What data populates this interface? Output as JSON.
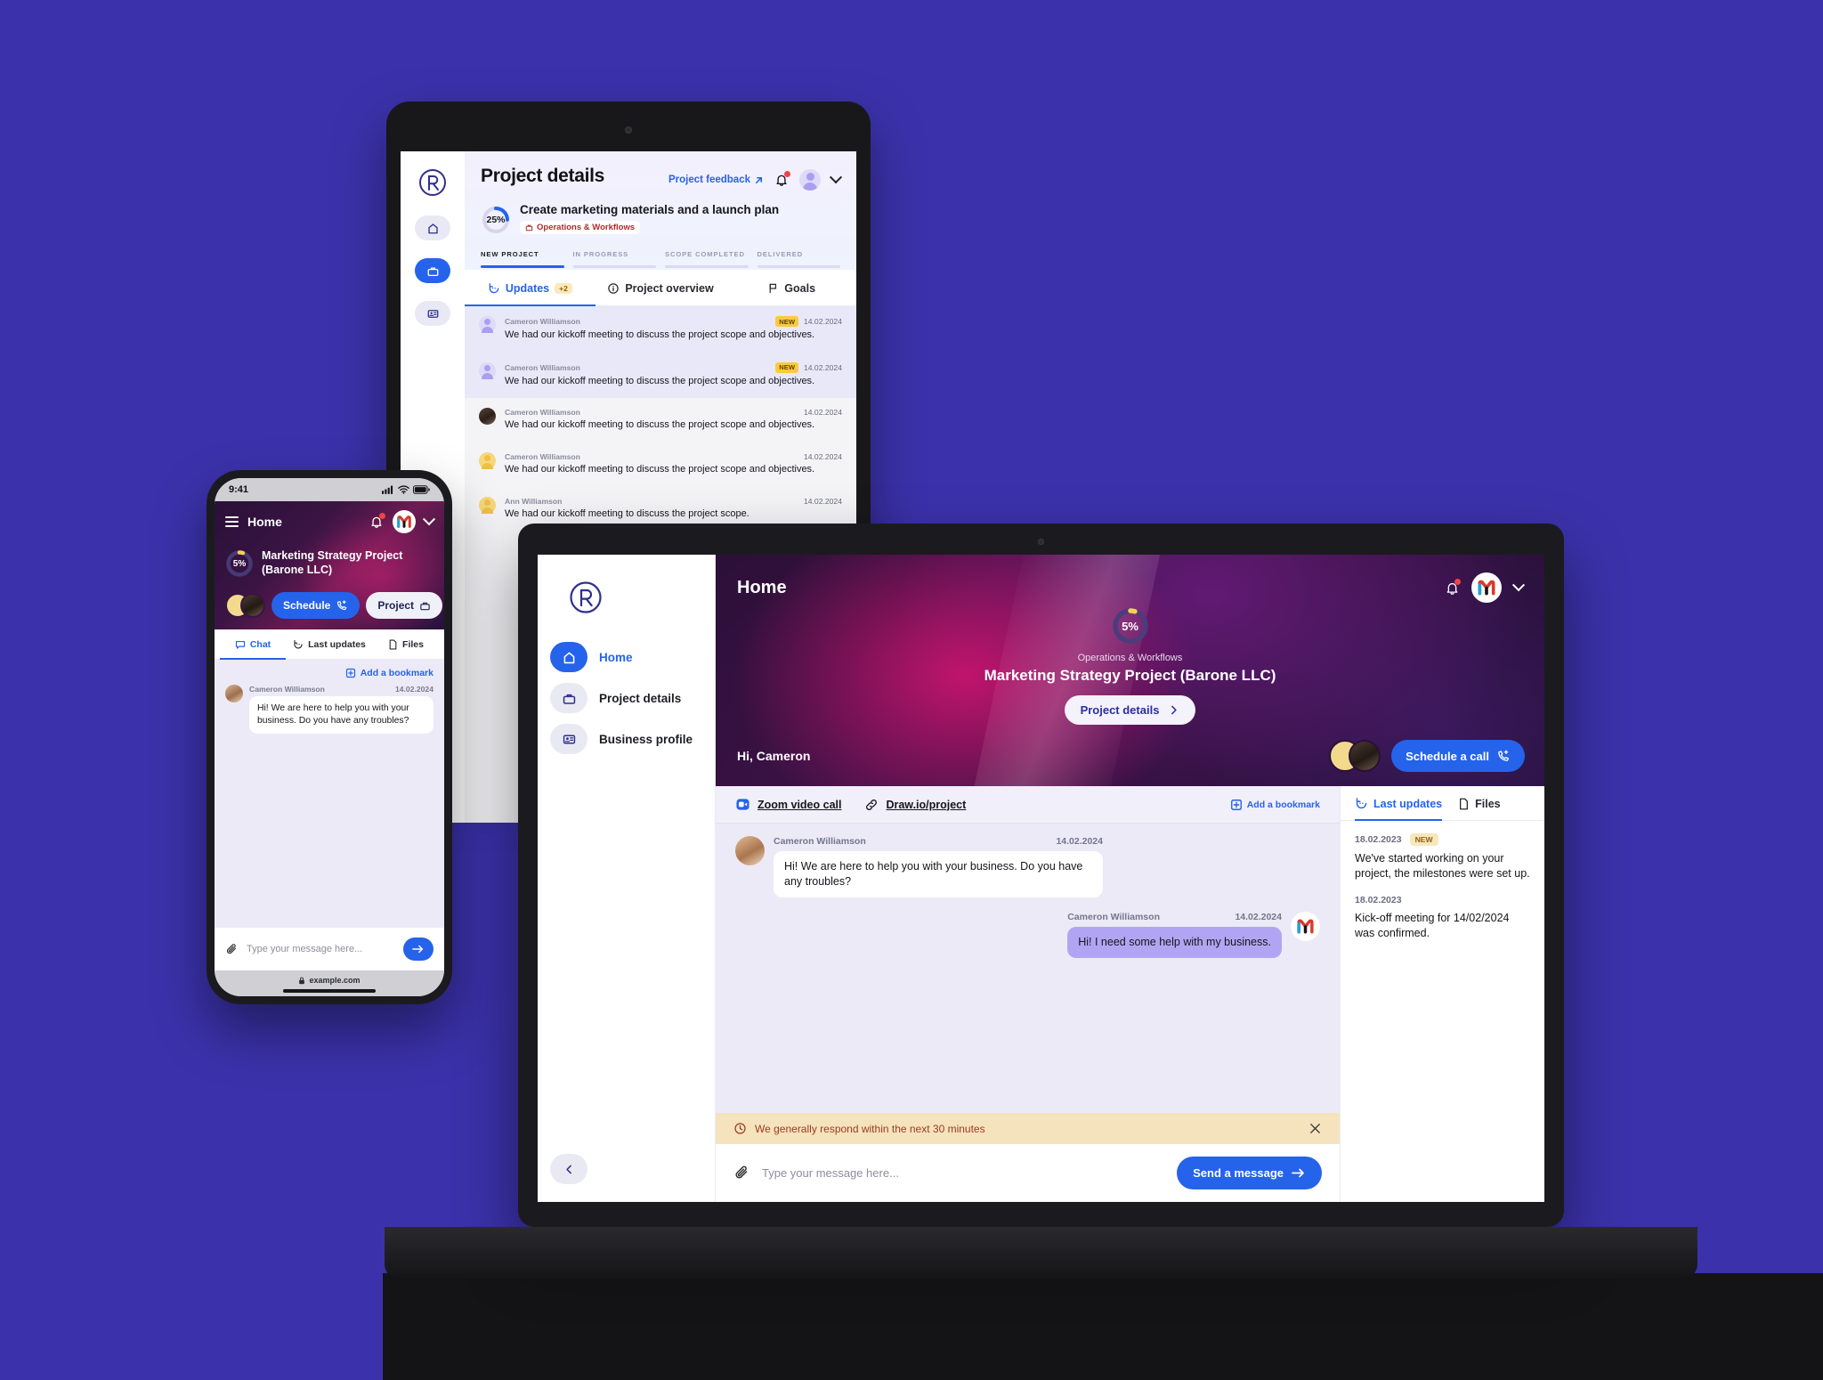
{
  "brand": {
    "logo_letter": "R",
    "accent": "#2563eb",
    "background": "#3b32ab"
  },
  "tablet": {
    "page_title": "Project details",
    "feedback_link": "Project feedback",
    "rail": [
      {
        "name": "home",
        "icon": "home-icon",
        "active": false
      },
      {
        "name": "project",
        "icon": "briefcase-icon",
        "active": true
      },
      {
        "name": "business-profile",
        "icon": "id-card-icon",
        "active": false
      }
    ],
    "progress_percent": "25%",
    "project_headline": "Create marketing materials and a launch plan",
    "project_tag": "Operations & Workflows",
    "stages": [
      {
        "label": "NEW PROJECT",
        "done": true
      },
      {
        "label": "IN PROGRESS",
        "done": false
      },
      {
        "label": "SCOPE COMPLETED",
        "done": false
      },
      {
        "label": "DELIVERED",
        "done": false
      }
    ],
    "tabs": [
      {
        "label": "Updates",
        "badge": "+2",
        "active": true
      },
      {
        "label": "Project overview",
        "badge": "",
        "active": false
      },
      {
        "label": "Goals",
        "badge": "",
        "active": false
      }
    ],
    "updates": [
      {
        "author": "Cameron Williamson",
        "badge": "NEW",
        "date": "14.02.2024",
        "text": "We had our kickoff meeting to discuss the project scope and objectives.",
        "unread": true,
        "avatar": "ph-purple"
      },
      {
        "author": "Cameron Williamson",
        "badge": "NEW",
        "date": "14.02.2024",
        "text": "We had our kickoff meeting to discuss the project scope and objectives.",
        "unread": true,
        "avatar": "ph-purple"
      },
      {
        "author": "Cameron Williamson",
        "badge": "",
        "date": "14.02.2024",
        "text": "We had our kickoff meeting to discuss the project scope and objectives.",
        "unread": false,
        "avatar": "photo"
      },
      {
        "author": "Cameron Williamson",
        "badge": "",
        "date": "14.02.2024",
        "text": "We had our kickoff meeting to discuss the project scope and objectives.",
        "unread": false,
        "avatar": "ph-yellow"
      },
      {
        "author": "Ann Williamson",
        "badge": "",
        "date": "14.02.2024",
        "text": "We had our kickoff meeting to discuss the project scope.",
        "unread": false,
        "avatar": "ph-yellow"
      }
    ]
  },
  "phone": {
    "status_time": "9:41",
    "nav_title": "Home",
    "progress_percent": "5%",
    "project_name": "Marketing Strategy Project (Barone LLC)",
    "schedule_button": "Schedule",
    "project_button": "Project",
    "tabs": [
      {
        "label": "Chat",
        "active": true
      },
      {
        "label": "Last updates",
        "active": false
      },
      {
        "label": "Files",
        "active": false
      }
    ],
    "bookmark_link": "Add a bookmark",
    "message": {
      "author": "Cameron Williamson",
      "date": "14.02.2024",
      "text": "Hi!  We are here to help you with your business. Do you have any troubles?"
    },
    "composer_placeholder": "Type your message here...",
    "url": "example.com"
  },
  "laptop": {
    "nav_title": "Home",
    "sidebar": [
      {
        "label": "Home",
        "icon": "home-icon",
        "active": true
      },
      {
        "label": "Project details",
        "icon": "briefcase-icon",
        "active": false
      },
      {
        "label": "Business profile",
        "icon": "id-card-icon",
        "active": false
      }
    ],
    "hero": {
      "progress_percent": "5%",
      "category": "Operations & Workflows",
      "project_title": "Marketing Strategy Project (Barone LLC)",
      "details_button": "Project details",
      "greeting": "Hi, Cameron",
      "call_button": "Schedule a call"
    },
    "chat_toolbar": {
      "zoom_link": "Zoom video call",
      "draw_link": "Draw.io/project",
      "bookmark_link": "Add a bookmark"
    },
    "messages": [
      {
        "side": "in",
        "author": "Cameron Williamson",
        "date": "14.02.2024",
        "text": "Hi!  We are here to help you with your business. Do you have any troubles?"
      },
      {
        "side": "out",
        "author": "Cameron Williamson",
        "date": "14.02.2024",
        "text": "Hi!  I need some help with my business."
      }
    ],
    "notice": "We generally respond within the next 30 minutes",
    "composer_placeholder": "Type your message here...",
    "send_button": "Send a message",
    "right_tabs": [
      {
        "label": "Last updates",
        "active": true
      },
      {
        "label": "Files",
        "active": false
      }
    ],
    "updates": [
      {
        "date": "18.02.2023",
        "badge": "NEW",
        "text": "We've started working on your project, the milestones were set up."
      },
      {
        "date": "18.02.2023",
        "badge": "",
        "text": "Kick-off meeting for 14/02/2024 was confirmed."
      }
    ]
  }
}
